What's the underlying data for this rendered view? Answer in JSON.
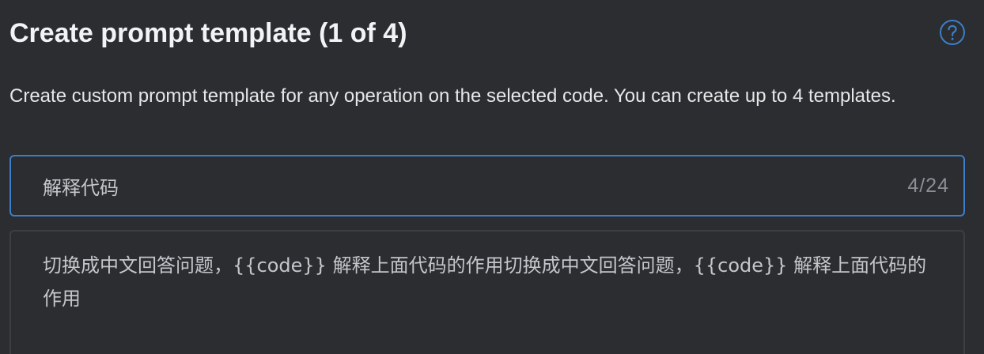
{
  "header": {
    "title": "Create prompt template (1 of 4)",
    "help_icon": "help-circle-icon",
    "help_color": "#3d7ec9"
  },
  "description": "Create custom prompt template for any operation on the selected code. You can create up to 4 templates.",
  "name_field": {
    "value": "解释代码",
    "counter": "4/24",
    "border_color": "#3d7ec9"
  },
  "prompt_field": {
    "value": "切换成中文回答问题，{{code}} 解释上面代码的作用切换成中文回答问题，{{code}} 解释上面代码的作用"
  }
}
